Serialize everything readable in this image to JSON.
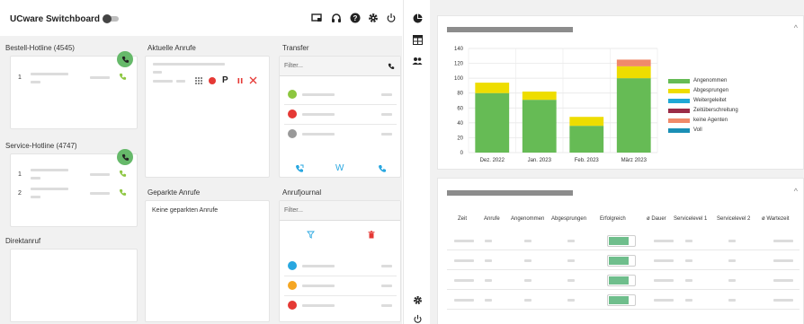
{
  "app": {
    "title": "UCware Switchboard"
  },
  "columns": {
    "hotline1_title": "Bestell-Hotline (4545)",
    "hotline2_title": "Service-Hotline (4747)",
    "direct_title": "Direktanruf",
    "current_calls_title": "Aktuelle Anrufe",
    "parked_title": "Geparkte Anrufe",
    "parked_empty": "Keine geparkten Anrufe",
    "transfer_title": "Transfer",
    "journal_title": "Anrufjournal"
  },
  "hotline1": {
    "slots": [
      "1"
    ]
  },
  "hotline2": {
    "slots": [
      "1",
      "2"
    ]
  },
  "current_call": {
    "park_label": "P"
  },
  "transfer": {
    "filter_placeholder": "Filter...",
    "w_label": "W"
  },
  "journal": {
    "filter_placeholder": "Filter..."
  },
  "colors": {
    "green": "#66b96a",
    "yellow": "#eedd00",
    "blue": "#1f9fd6",
    "maroon": "#9b2c47",
    "salmon": "#f08a6a",
    "teal": "#1a8fb5",
    "red": "#e53935"
  },
  "chart_data": {
    "type": "bar",
    "categories": [
      "Dez. 2022",
      "Jan. 2023",
      "Feb. 2023",
      "März 2023"
    ],
    "ylim": [
      0,
      140
    ],
    "yticks": [
      0,
      20,
      40,
      60,
      80,
      100,
      120,
      140
    ],
    "series": [
      {
        "name": "Angenommen",
        "color": "#66bb55",
        "values": [
          80,
          71,
          36,
          100
        ]
      },
      {
        "name": "Abgesprungen",
        "color": "#eedd00",
        "values": [
          14,
          11,
          12,
          16
        ]
      },
      {
        "name": "Weitergeleitet",
        "color": "#1fa8d6",
        "values": [
          0,
          0,
          0,
          0
        ]
      },
      {
        "name": "Zeitüberschreitung",
        "color": "#9b2c47",
        "values": [
          0,
          0,
          0,
          0
        ]
      },
      {
        "name": "keine Agenten",
        "color": "#f08a6a",
        "values": [
          0,
          0,
          0,
          9
        ]
      },
      {
        "name": "Voll",
        "color": "#1a8fb5",
        "values": [
          0,
          0,
          0,
          0
        ]
      }
    ],
    "grid": true,
    "legend": "right"
  },
  "table": {
    "headers": [
      "Zeit",
      "Anrufe",
      "Angenommen",
      "Abgesprungen",
      "Erfolgreich",
      "ø Dauer",
      "Servicelevel 1",
      "Servicelevel 2",
      "ø Wartezeit"
    ],
    "rows": [
      {
        "success": 0.8
      },
      {
        "success": 0.8
      },
      {
        "success": 0.8
      },
      {
        "success": 0.8
      }
    ]
  }
}
